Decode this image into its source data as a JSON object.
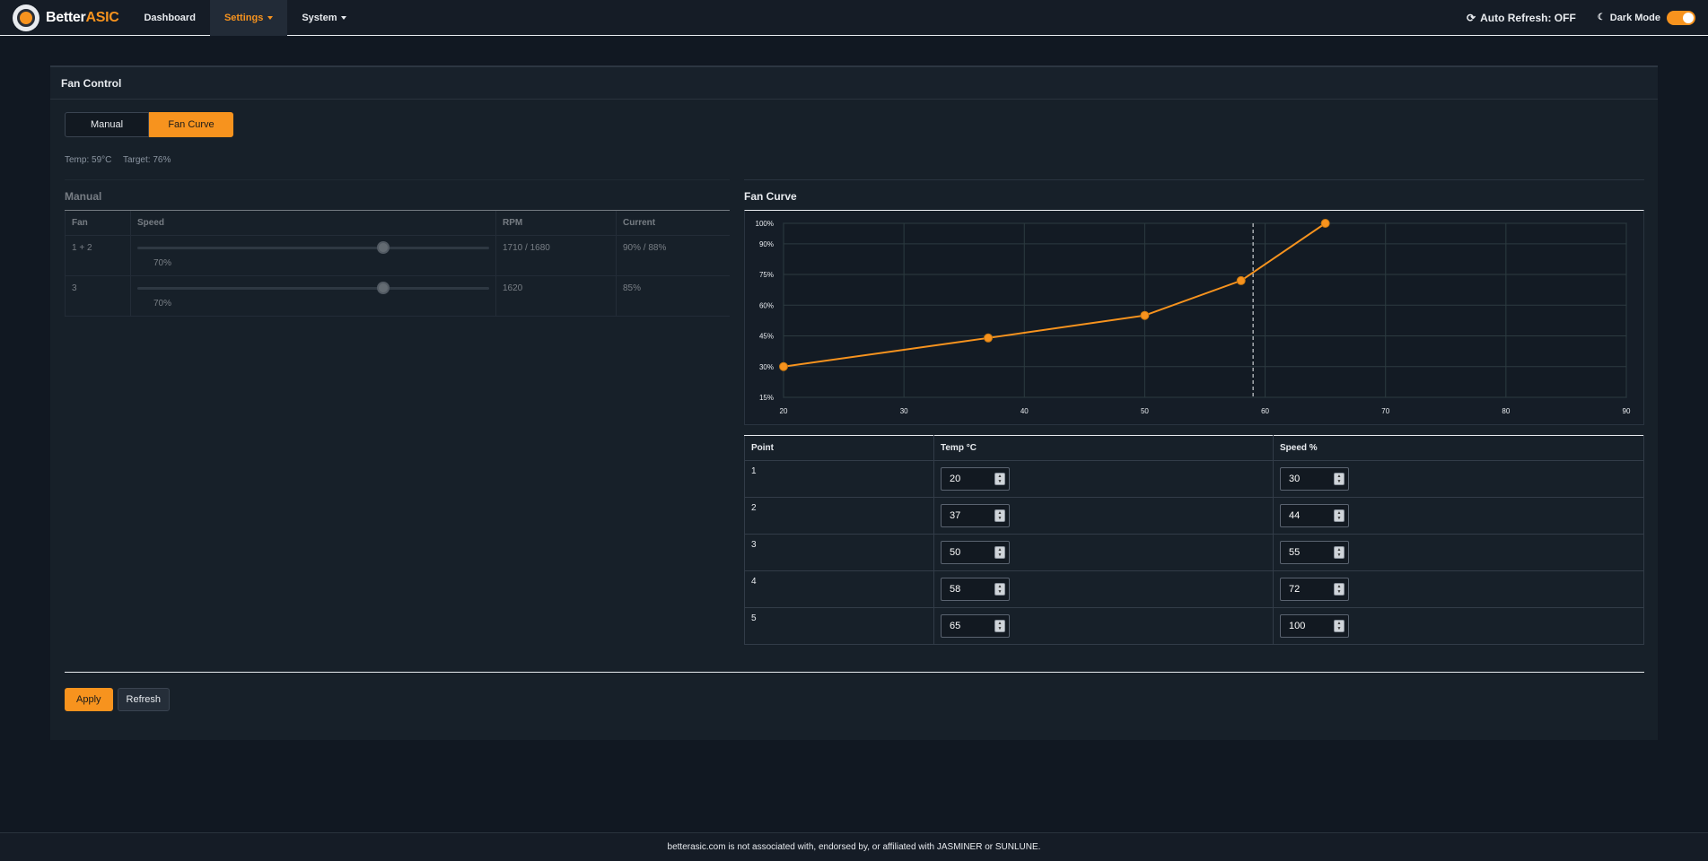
{
  "brand": {
    "name_part1": "Better",
    "name_part2": "ASIC",
    "logo_icon": "chip-logo-icon"
  },
  "nav": {
    "dashboard": "Dashboard",
    "settings": "Settings",
    "system": "System",
    "auto_refresh": "Auto Refresh: OFF",
    "dark_mode": "Dark Mode",
    "dark_mode_on": true
  },
  "card": {
    "title": "Fan Control",
    "modes": {
      "manual": "Manual",
      "curve": "Fan Curve",
      "selected": "Fan Curve"
    },
    "status": {
      "temp": "Temp: 59°C",
      "target": "Target: 76%"
    }
  },
  "manual": {
    "title": "Manual",
    "headers": {
      "fan": "Fan",
      "speed": "Speed",
      "rpm": "RPM",
      "current": "Current"
    },
    "rows": [
      {
        "fan": "1 + 2",
        "speed": 70,
        "speed_label": "70%",
        "rpm": "1710 / 1680",
        "current": "90% / 88%"
      },
      {
        "fan": "3",
        "speed": 70,
        "speed_label": "70%",
        "rpm": "1620",
        "current": "85%"
      }
    ]
  },
  "curve": {
    "title": "Fan Curve",
    "headers": {
      "point": "Point",
      "temp": "Temp °C",
      "speed": "Speed %"
    },
    "points": [
      {
        "n": "1",
        "temp": "20",
        "speed": "30"
      },
      {
        "n": "2",
        "temp": "37",
        "speed": "44"
      },
      {
        "n": "3",
        "temp": "50",
        "speed": "55"
      },
      {
        "n": "4",
        "temp": "58",
        "speed": "72"
      },
      {
        "n": "5",
        "temp": "65",
        "speed": "100"
      }
    ]
  },
  "chart_data": {
    "type": "line",
    "x": [
      20,
      37,
      50,
      58,
      65
    ],
    "y": [
      30,
      44,
      55,
      72,
      100
    ],
    "xlim": [
      20,
      90
    ],
    "ylim": [
      15,
      100
    ],
    "xticks": [
      "20",
      "30",
      "40",
      "50",
      "60",
      "70",
      "80",
      "90"
    ],
    "yticks": [
      "100%",
      "90%",
      "75%",
      "60%",
      "45%",
      "30%",
      "15%"
    ],
    "ytick_values": [
      100,
      90,
      75,
      60,
      45,
      30,
      15
    ],
    "current_temp": 59,
    "grid": true,
    "line_color": "#f7931e"
  },
  "buttons": {
    "apply": "Apply",
    "refresh": "Refresh"
  },
  "footer": {
    "text": "betterasic.com is not associated with, endorsed by, or affiliated with JASMINER or SUNLUNE."
  },
  "colors": {
    "accent": "#f7931e",
    "background": "#111822",
    "card": "#172029"
  }
}
